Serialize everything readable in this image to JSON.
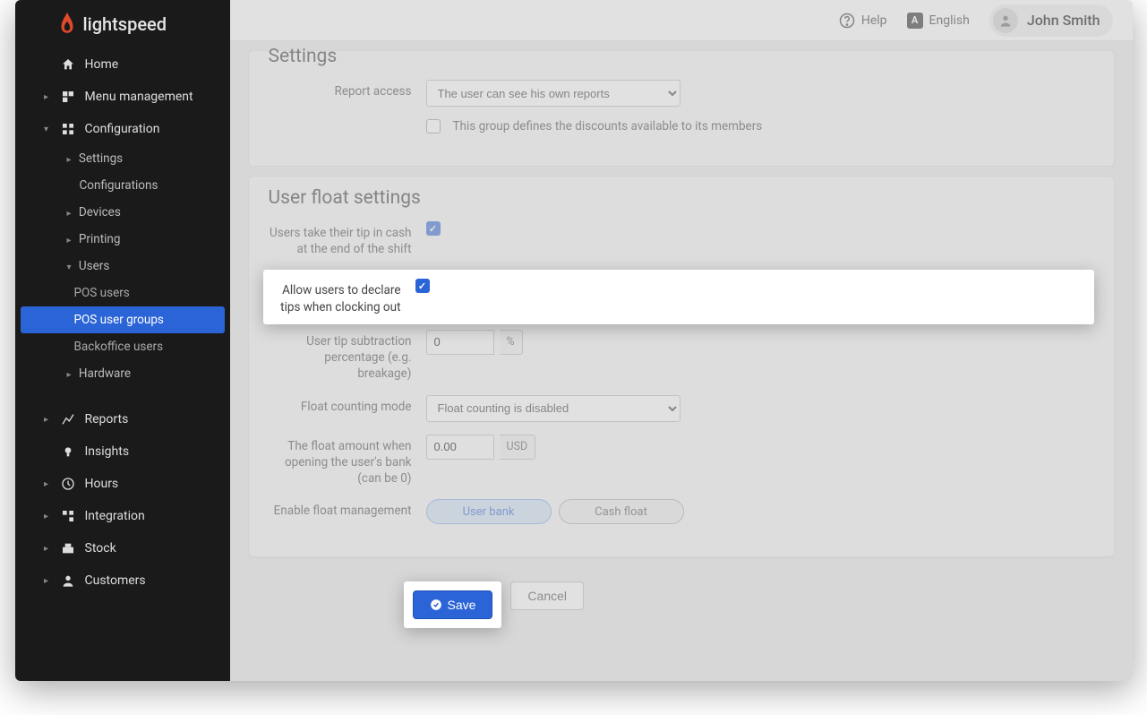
{
  "brand": "lightspeed",
  "topbar": {
    "help": "Help",
    "lang": "English",
    "user": "John Smith"
  },
  "sidebar": {
    "home": "Home",
    "menu": "Menu management",
    "config": "Configuration",
    "settings": "Settings",
    "configurations": "Configurations",
    "devices": "Devices",
    "printing": "Printing",
    "users": "Users",
    "pos_users": "POS users",
    "pos_user_groups": "POS user groups",
    "backoffice_users": "Backoffice users",
    "hardware": "Hardware",
    "reports": "Reports",
    "insights": "Insights",
    "hours": "Hours",
    "integration": "Integration",
    "stock": "Stock",
    "customers": "Customers"
  },
  "settings_panel": {
    "title": "Settings",
    "report_access_label": "Report access",
    "report_access_value": "The user can see his own reports",
    "discounts_checkbox": "This group defines the discounts available to its members"
  },
  "float_panel": {
    "title": "User float settings",
    "tip_cash_label": "Users take their tip in cash at the end of the shift",
    "declare_tips_label": "Allow users to declare tips when clocking out",
    "subtraction_label": "User tip subtraction percentage (e.g. breakage)",
    "subtraction_value": "0",
    "subtraction_unit": "%",
    "float_mode_label": "Float counting mode",
    "float_mode_value": "Float counting is disabled",
    "float_amount_label": "The float amount when opening the user's bank (can be 0)",
    "float_amount_value": "0.00",
    "float_amount_unit": "USD",
    "enable_float_label": "Enable float management",
    "user_bank": "User bank",
    "cash_float": "Cash float"
  },
  "actions": {
    "save": "Save",
    "cancel": "Cancel"
  }
}
